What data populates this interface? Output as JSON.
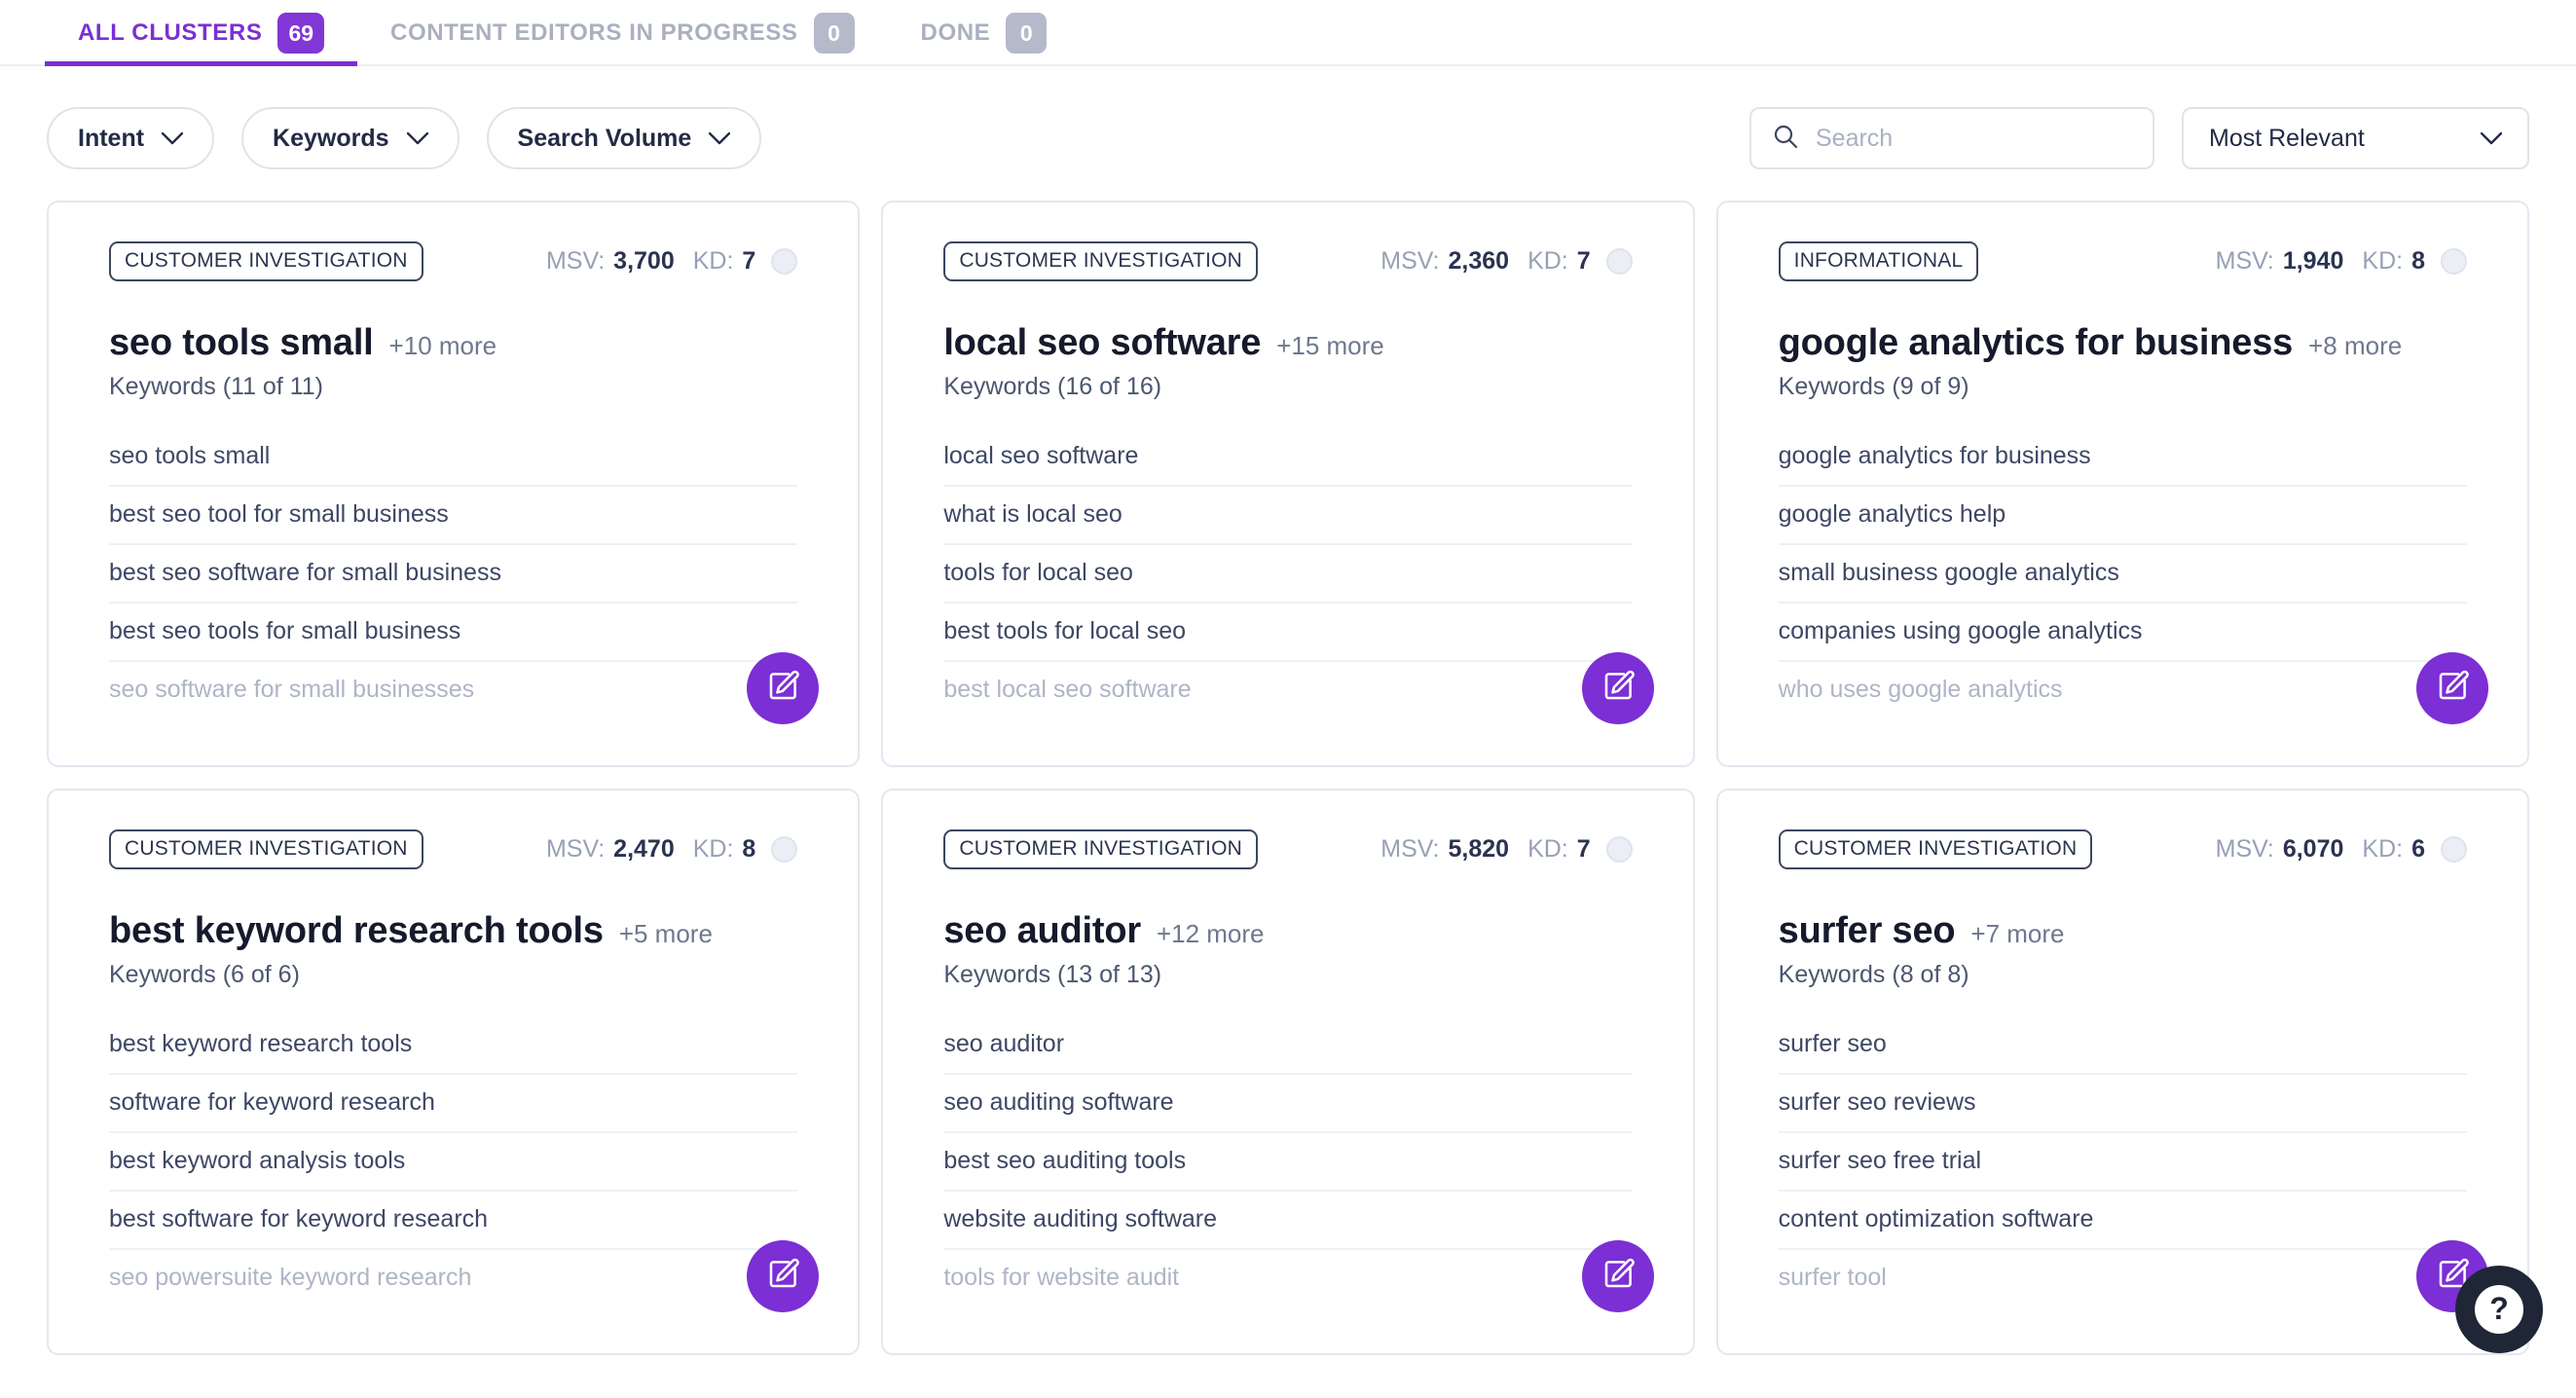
{
  "tabs": [
    {
      "label": "ALL CLUSTERS",
      "count": "69",
      "active": true
    },
    {
      "label": "CONTENT EDITORS IN PROGRESS",
      "count": "0",
      "active": false
    },
    {
      "label": "DONE",
      "count": "0",
      "active": false
    }
  ],
  "filters": [
    {
      "label": "Intent",
      "icon": "chevron-down-icon"
    },
    {
      "label": "Keywords",
      "icon": "chevron-down-icon"
    },
    {
      "label": "Search Volume",
      "icon": "chevron-down-icon"
    }
  ],
  "search": {
    "placeholder": "Search",
    "value": "",
    "icon": "search-icon"
  },
  "sort": {
    "selected": "Most Relevant",
    "icon": "chevron-down-icon"
  },
  "help": {
    "label": "?",
    "icon": "question-mark-icon"
  },
  "metric_labels": {
    "msv": "MSV:",
    "kd": "KD:"
  },
  "edit_icon": "edit-pencil-icon",
  "colors": {
    "accent_purple": "#7B2FD4",
    "badge_purple": "#8236D6",
    "tab_inactive": "#AAB0BF",
    "card_border": "#E4E7F0",
    "help_dark": "#1F2636"
  },
  "cards": [
    {
      "intent": "CUSTOMER INVESTIGATION",
      "msv": "3,700",
      "kd": "7",
      "title": "seo tools small",
      "more": "+10 more",
      "subtitle": "Keywords (11 of 11)",
      "keywords": [
        "seo tools small",
        "best seo tool for small business",
        "best seo software for small business",
        "best seo tools for small business",
        "seo software for small businesses"
      ]
    },
    {
      "intent": "CUSTOMER INVESTIGATION",
      "msv": "2,360",
      "kd": "7",
      "title": "local seo software",
      "more": "+15 more",
      "subtitle": "Keywords (16 of 16)",
      "keywords": [
        "local seo software",
        "what is local seo",
        "tools for local seo",
        "best tools for local seo",
        "best local seo software"
      ]
    },
    {
      "intent": "INFORMATIONAL",
      "msv": "1,940",
      "kd": "8",
      "title": "google analytics for business",
      "more": "+8 more",
      "subtitle": "Keywords (9 of 9)",
      "keywords": [
        "google analytics for business",
        "google analytics help",
        "small business google analytics",
        "companies using google analytics",
        "who uses google analytics"
      ]
    },
    {
      "intent": "CUSTOMER INVESTIGATION",
      "msv": "2,470",
      "kd": "8",
      "title": "best keyword research tools",
      "more": "+5 more",
      "subtitle": "Keywords (6 of 6)",
      "keywords": [
        "best keyword research tools",
        "software for keyword research",
        "best keyword analysis tools",
        "best software for keyword research",
        "seo powersuite keyword research"
      ]
    },
    {
      "intent": "CUSTOMER INVESTIGATION",
      "msv": "5,820",
      "kd": "7",
      "title": "seo auditor",
      "more": "+12 more",
      "subtitle": "Keywords (13 of 13)",
      "keywords": [
        "seo auditor",
        "seo auditing software",
        "best seo auditing tools",
        "website auditing software",
        "tools for website audit"
      ]
    },
    {
      "intent": "CUSTOMER INVESTIGATION",
      "msv": "6,070",
      "kd": "6",
      "title": "surfer seo",
      "more": "+7 more",
      "subtitle": "Keywords (8 of 8)",
      "keywords": [
        "surfer seo",
        "surfer seo reviews",
        "surfer seo free trial",
        "content optimization software",
        "surfer tool"
      ]
    }
  ]
}
